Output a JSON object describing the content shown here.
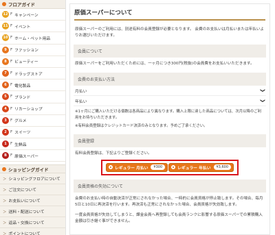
{
  "sidebar": {
    "floor_heading": "フロアガイド",
    "floors": [
      {
        "num": "12",
        "label": "キャンペーン",
        "color": "#e8a21e"
      },
      {
        "num": "11",
        "label": "イベント",
        "color": "#e8a21e"
      },
      {
        "num": "10",
        "label": "ホーム・ペット用品",
        "color": "#e8a21e"
      },
      {
        "num": "9",
        "label": "ファッション",
        "color": "#e8761e"
      },
      {
        "num": "8",
        "label": "ビューティー",
        "color": "#e8761e"
      },
      {
        "num": "7",
        "label": "ドラッグストア",
        "color": "#e2631c"
      },
      {
        "num": "6",
        "label": "電化製品",
        "color": "#e2631c"
      },
      {
        "num": "5",
        "label": "ブランド",
        "color": "#d9481a"
      },
      {
        "num": "4",
        "label": "リカーショップ",
        "color": "#d9481a"
      },
      {
        "num": "3",
        "label": "グルメ",
        "color": "#d2361b"
      },
      {
        "num": "2",
        "label": "スイーツ",
        "color": "#d2361b"
      },
      {
        "num": "1",
        "label": "生鮮品",
        "color": "#c7281c"
      },
      {
        "num": "B",
        "label": "原価スーパー",
        "color": "#b51f1c"
      }
    ],
    "floor_suffix": "F",
    "shop_heading": "ショッピングガイド",
    "shop_items": [
      {
        "label": "ショッピングフロアについて"
      },
      {
        "label": "ご注文について"
      },
      {
        "label": "お支払いについて"
      },
      {
        "label": "送料・配送について"
      },
      {
        "label": "返品・交換について"
      },
      {
        "label": "ポイントについて"
      }
    ],
    "shop_chevron": "＞"
  },
  "main": {
    "title": "原価スーパーについて",
    "intro": "原価スーパーのご利用には、別途有料の会員登録が必要となります。 会費のお支払いは月払いまたは年払いよりお選びいただけます。",
    "membership_head": "会員について",
    "membership_body": "原価スーパーをご利用いただくためには、一ヶ月につき300円(税抜)の会員費をお支払いいただきます。",
    "payment_head": "会費のお支払い方法",
    "monthly_label": "月払い",
    "yearly_label": "年払い",
    "chevron": "❯",
    "note1": "※1ヶ月にご購入いただける個数は各商品により異なります。購入上限に達した商品については、次月以降のご利用をお待ちいただきます。",
    "note2": "※有料会員登録はクレジットカード決済のみとなります。予めご了承ください。",
    "register_head": "会員登録",
    "register_body": "有料会員登録は、下記よりご登録ください。",
    "plans": [
      {
        "label": "レギュラー 月払い",
        "price": "¥300"
      },
      {
        "label": "レギュラー 年払い",
        "price": "¥3,600"
      }
    ],
    "lapse_head": "会員資格の失効について",
    "lapse_body1": "会費のお支払い時の自動決済が正常にされなかった場合、一時的に会員資格が停止致します。その場合、毎月5日と10日に再決済を行います。再決済も正常にされなかった場合、会員資格が失効致します。",
    "lapse_body2": "一度会員資格が失効してしまうと、課金会員へ再登録しても会員ランクに影響する原価スーパーでの累積購入金額は引き継ぐ事ができません。"
  }
}
